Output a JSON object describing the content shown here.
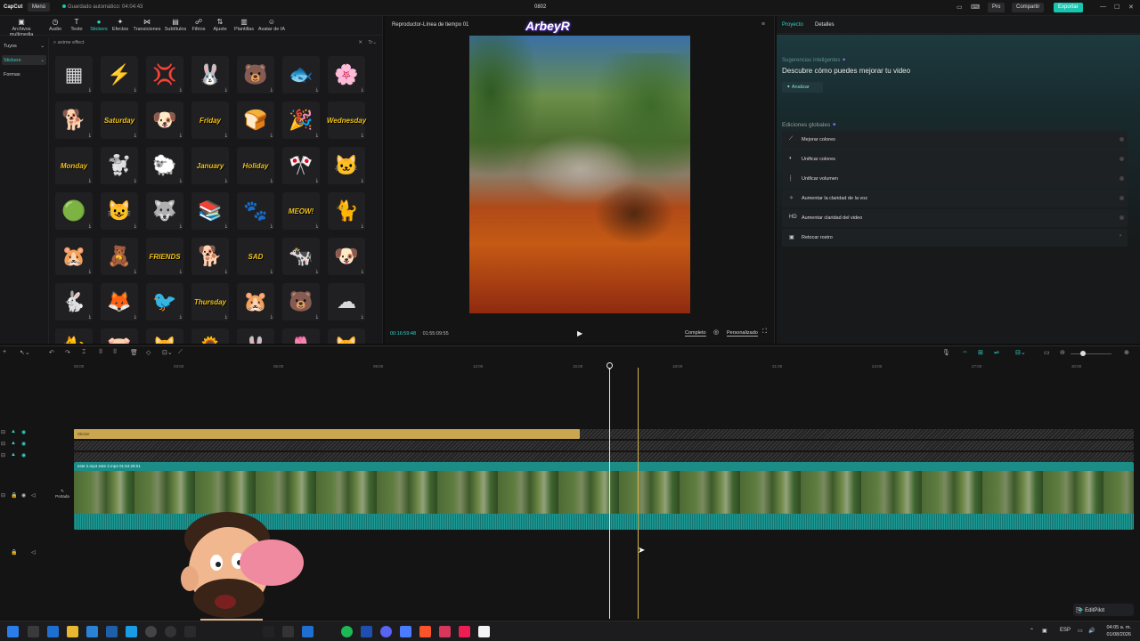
{
  "titlebar": {
    "app_name": "CapCut",
    "menu_label": "Menú",
    "autosave": "Guardado automático: 04:04:43",
    "project_name": "0802",
    "pro_label": "Pro",
    "share_label": "Compartir",
    "export_label": "Exportar"
  },
  "left_panel": {
    "tabs": [
      {
        "label": "Archivos multimedia",
        "icon": "media-icon"
      },
      {
        "label": "Audio",
        "icon": "audio-icon"
      },
      {
        "label": "Texto",
        "icon": "text-icon"
      },
      {
        "label": "Stickers",
        "icon": "sticker-icon"
      },
      {
        "label": "Efectos",
        "icon": "effects-icon"
      },
      {
        "label": "Transiciones",
        "icon": "transitions-icon"
      },
      {
        "label": "Subtítulos",
        "icon": "subtitles-icon"
      },
      {
        "label": "Filtros",
        "icon": "filters-icon"
      },
      {
        "label": "Ajuste",
        "icon": "adjust-icon"
      },
      {
        "label": "Plantillas",
        "icon": "templates-icon"
      },
      {
        "label": "Avatar de IA",
        "icon": "ai-avatar-icon"
      }
    ],
    "categories": [
      "Tuyos",
      "Stickers",
      "Formas"
    ],
    "search_value": "anime effect",
    "stickers": [
      {
        "kind": "emoji",
        "content": "▦"
      },
      {
        "kind": "emoji",
        "content": "⚡"
      },
      {
        "kind": "emoji",
        "content": "💢"
      },
      {
        "kind": "emoji",
        "content": "🐰"
      },
      {
        "kind": "emoji",
        "content": "🐻"
      },
      {
        "kind": "emoji",
        "content": "🐟"
      },
      {
        "kind": "emoji",
        "content": "🌸"
      },
      {
        "kind": "emoji",
        "content": "🐕"
      },
      {
        "kind": "text",
        "content": "Saturday"
      },
      {
        "kind": "emoji",
        "content": "🐶"
      },
      {
        "kind": "text",
        "content": "Friday"
      },
      {
        "kind": "emoji",
        "content": "🍞"
      },
      {
        "kind": "emoji",
        "content": "🎉"
      },
      {
        "kind": "text",
        "content": "Wednesday"
      },
      {
        "kind": "text",
        "content": "Monday"
      },
      {
        "kind": "emoji",
        "content": "🐩"
      },
      {
        "kind": "emoji",
        "content": "🐑"
      },
      {
        "kind": "text",
        "content": "January"
      },
      {
        "kind": "text",
        "content": "Holiday"
      },
      {
        "kind": "emoji",
        "content": "🎌"
      },
      {
        "kind": "emoji",
        "content": "🐱"
      },
      {
        "kind": "emoji",
        "content": "🟢"
      },
      {
        "kind": "emoji",
        "content": "😺"
      },
      {
        "kind": "emoji",
        "content": "🐺"
      },
      {
        "kind": "emoji",
        "content": "📚"
      },
      {
        "kind": "emoji",
        "content": "🐾"
      },
      {
        "kind": "text",
        "content": "MEOW!"
      },
      {
        "kind": "emoji",
        "content": "🐈"
      },
      {
        "kind": "emoji",
        "content": "🐹"
      },
      {
        "kind": "emoji",
        "content": "🧸"
      },
      {
        "kind": "text",
        "content": "FRIENDS"
      },
      {
        "kind": "emoji",
        "content": "🐕"
      },
      {
        "kind": "text",
        "content": "SAD"
      },
      {
        "kind": "emoji",
        "content": "🐄"
      },
      {
        "kind": "emoji",
        "content": "🐶"
      },
      {
        "kind": "emoji",
        "content": "🐇"
      },
      {
        "kind": "emoji",
        "content": "🦊"
      },
      {
        "kind": "emoji",
        "content": "🐦"
      },
      {
        "kind": "text",
        "content": "Thursday"
      },
      {
        "kind": "emoji",
        "content": "🐹"
      },
      {
        "kind": "emoji",
        "content": "🐻"
      },
      {
        "kind": "emoji",
        "content": "☁"
      },
      {
        "kind": "emoji",
        "content": "🐈"
      },
      {
        "kind": "emoji",
        "content": "🐷"
      },
      {
        "kind": "emoji",
        "content": "🐱"
      },
      {
        "kind": "emoji",
        "content": "🌻"
      },
      {
        "kind": "emoji",
        "content": "🐰"
      },
      {
        "kind": "emoji",
        "content": "🌷"
      },
      {
        "kind": "emoji",
        "content": "🐱"
      }
    ]
  },
  "player": {
    "title": "Reproductor-Línea de tiempo 01",
    "overlay_logo": "ArbeyR",
    "current_time": "00:16:59:48",
    "total_time": "01:55:09:55",
    "full_label": "Completo",
    "ratio_label": "Personalizado"
  },
  "right_panel": {
    "tabs": [
      "Proyecto",
      "Detalles"
    ],
    "smart_label": "Sugerencias inteligentes",
    "smart_title": "Descubre cómo puedes mejorar tu video",
    "analyze_label": "Analizar",
    "global_label": "Ediciones globales",
    "options": [
      {
        "label": "Mejorar colores",
        "icon": "color-wand-icon"
      },
      {
        "label": "Unificar colores",
        "icon": "color-sync-icon"
      },
      {
        "label": "Unificar volumen",
        "icon": "volume-icon"
      },
      {
        "label": "Aumentar la claridad de la voz",
        "icon": "voice-icon"
      },
      {
        "label": "Aumentar claridad del video",
        "icon": "hd-icon"
      },
      {
        "label": "Retocar rostro",
        "icon": "face-icon"
      }
    ]
  },
  "timeline": {
    "ruler_ticks": [
      "00:00",
      "03:00",
      "06:00",
      "09:00",
      "12:00",
      "15:00",
      "18:00",
      "21:00",
      "24:00",
      "27:00",
      "30:00"
    ],
    "sticker_track_label": "Sticker",
    "main_track_label": "este 2.mp4   este 2.mp4   01:54:29:01",
    "cover_label": "Portada"
  },
  "overlay": {
    "editpilot_label": "EditPilot"
  },
  "taskbar": {
    "language": "ESP",
    "time": "04:05 a. m.",
    "date": "01/08/2026"
  },
  "colors": {
    "accent": "#2fd3c6",
    "export": "#18c5b0",
    "sticker_track": "#c9a64f",
    "video_track": "#1c8c87"
  }
}
